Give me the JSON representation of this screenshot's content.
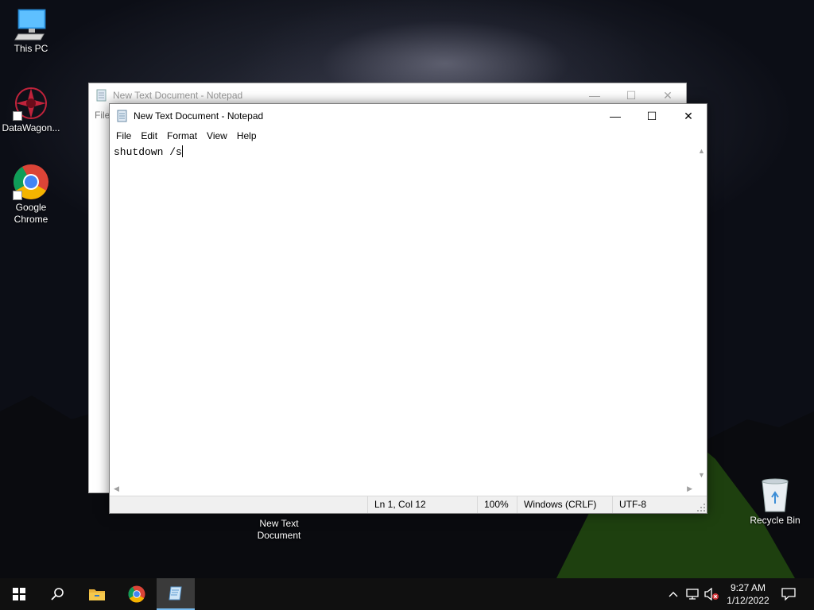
{
  "desktop": {
    "icons": [
      {
        "label": "This PC"
      },
      {
        "label": "DataWagon..."
      },
      {
        "label": "Google Chrome"
      },
      {
        "label": "New Text Document"
      },
      {
        "label": "Recycle Bin"
      }
    ]
  },
  "back_window": {
    "title": "New Text Document - Notepad",
    "menu_first": "File"
  },
  "notepad": {
    "title": "New Text Document - Notepad",
    "menu": [
      "File",
      "Edit",
      "Format",
      "View",
      "Help"
    ],
    "content": "shutdown /s",
    "status": {
      "position": "Ln 1, Col 12",
      "zoom": "100%",
      "line_ending": "Windows (CRLF)",
      "encoding": "UTF-8"
    }
  },
  "taskbar": {
    "items": [
      "start-icon",
      "search-icon",
      "file-explorer-icon",
      "chrome-icon",
      "notepad-icon"
    ],
    "clock": {
      "time": "9:27 AM",
      "date": "1/12/2022"
    }
  },
  "colors": {
    "taskbar": "#101010",
    "active_indicator": "#76b9ed",
    "tent_green": "#6fd02a"
  }
}
